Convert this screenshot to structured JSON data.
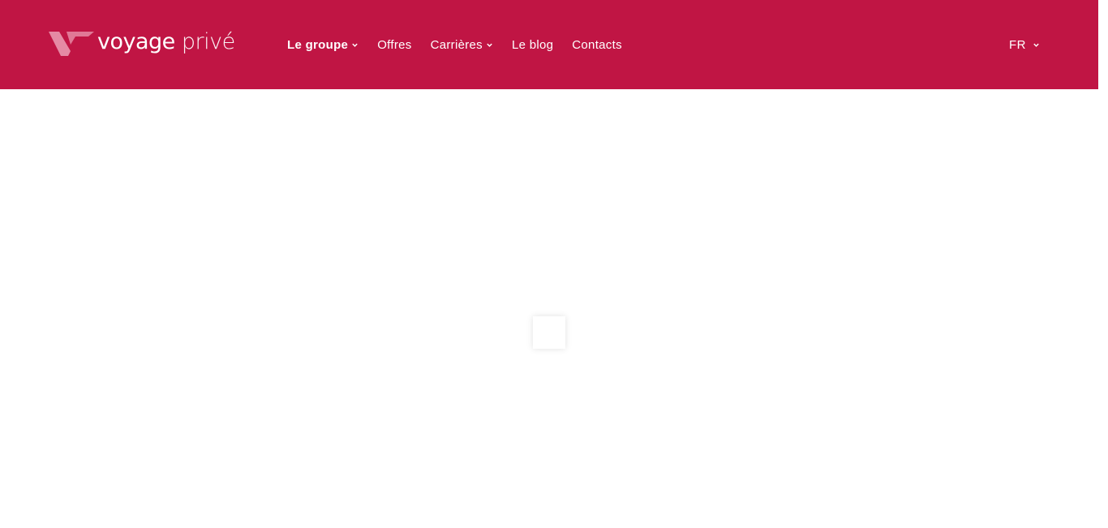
{
  "colors": {
    "brand": "#c01544",
    "logo_mark_light": "#e58aa4",
    "text_on_brand": "#ffffff",
    "background": "#ffffff"
  },
  "header": {
    "logo": {
      "word1": "voyage",
      "word2": "privé",
      "icon": "voyage-prive-v-icon"
    },
    "nav": [
      {
        "label": "Le groupe",
        "has_dropdown": true,
        "active": true
      },
      {
        "label": "Offres",
        "has_dropdown": false,
        "active": false
      },
      {
        "label": "Carrières",
        "has_dropdown": true,
        "active": false
      },
      {
        "label": "Le blog",
        "has_dropdown": false,
        "active": false
      },
      {
        "label": "Contacts",
        "has_dropdown": false,
        "active": false
      }
    ],
    "language": {
      "label": "FR",
      "icon": "chevron-down-icon"
    }
  }
}
